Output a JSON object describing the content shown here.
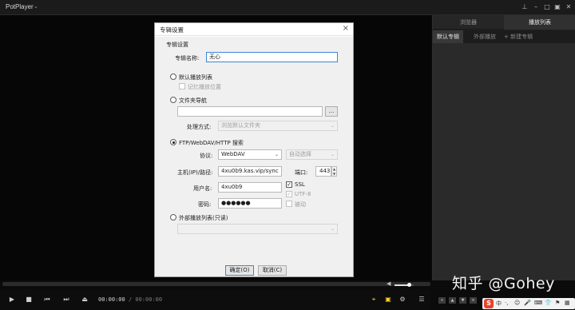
{
  "app": {
    "title": "PotPlayer",
    "menu_arrow": "⌄"
  },
  "window_controls": [
    "pin-icon",
    "minimize-icon",
    "restore-icon",
    "fullscreen-icon",
    "close-icon"
  ],
  "right_panel": {
    "tabs": [
      {
        "label": "浏览器",
        "active": false
      },
      {
        "label": "播放列表",
        "active": true
      }
    ],
    "subtabs": [
      {
        "label": "默认专辑",
        "active": true
      },
      {
        "label": "外部播放",
        "active": false
      },
      {
        "label": "+ 新建专辑",
        "active": false
      }
    ]
  },
  "dialog": {
    "title": "专辑设置",
    "close": "×",
    "section_label": "专辑设置",
    "album_name_label": "专辑名称:",
    "album_name_value": "无心",
    "default_list_option": "默认播放列表",
    "remember_pos_label": "记忆播放位置",
    "folder_nav_option": "文件夹导航",
    "folder_path_value": "",
    "browse_button": "...",
    "process_label": "处理方式:",
    "process_value": "浏览默认文件夹",
    "ftp_option": "FTP/WebDAV/HTTP 搜索",
    "protocol_label": "协议:",
    "protocol_value": "WebDAV",
    "encoding_value": "自动选择",
    "host_label": "主机(IP)/路径:",
    "host_value": "4xu0b9.kas.vip/sync",
    "port_label": "端口:",
    "port_value": "443",
    "user_label": "用户名:",
    "user_value": "4xu0b9",
    "ssl_label": "SSL",
    "utf8_label": "UTF-8",
    "password_label": "密码:",
    "password_value": "●●●●●●",
    "passive_label": "被动",
    "external_option": "外部播放列表(只读)",
    "external_value": "",
    "ok_button": "确定(O)",
    "cancel_button": "取消(C)"
  },
  "player": {
    "time_current": "00:00:00",
    "time_separator": "/",
    "time_total": "00:00:00",
    "volume_level": 0.75
  },
  "watermark": "知乎 @Gohey",
  "ime": {
    "logo": "S",
    "lang": "中",
    "items": [
      "·,",
      "☺",
      "🎤",
      "⌨",
      "👕",
      "⚑",
      "▦"
    ]
  },
  "colors": {
    "accent": "#3a86d6",
    "toggle_active": "#ffd21f",
    "panel_bg": "#2a2a2a",
    "ime_brand": "#e8432a"
  }
}
